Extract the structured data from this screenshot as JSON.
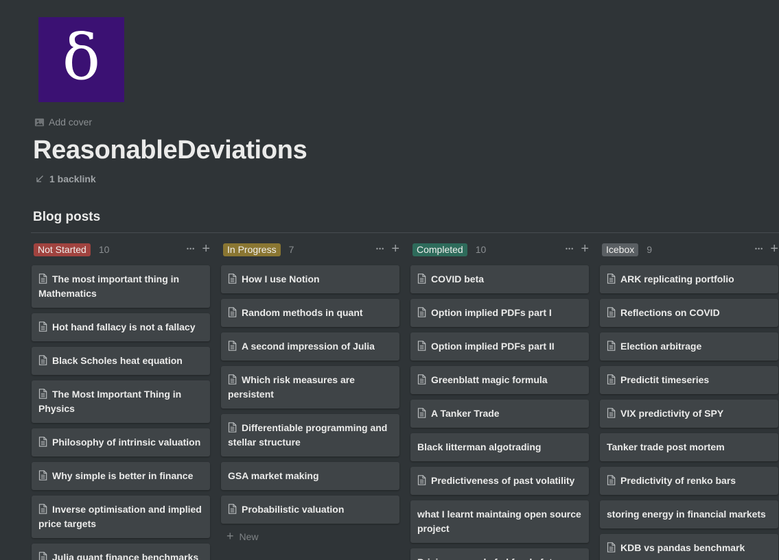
{
  "page": {
    "icon_glyph": "δ",
    "icon_bg": "#3b1173",
    "add_cover": "Add cover",
    "title": "ReasonableDeviations",
    "backlinks": "1 backlink"
  },
  "database": {
    "title": "Blog posts",
    "new_label": "New",
    "columns": [
      {
        "name": "Not Started",
        "count": "10",
        "color": "#a0433f",
        "cards": [
          {
            "title": "The most important thing in Mathematics",
            "icon": true
          },
          {
            "title": "Hot hand fallacy is not a fallacy",
            "icon": true
          },
          {
            "title": "Black Scholes heat equation",
            "icon": true
          },
          {
            "title": "The Most Important Thing in Physics",
            "icon": true
          },
          {
            "title": "Philosophy of intrinsic valuation",
            "icon": true
          },
          {
            "title": "Why simple is better in finance",
            "icon": true
          },
          {
            "title": "Inverse optimisation and implied price targets",
            "icon": true
          },
          {
            "title": "Julia quant finance benchmarks",
            "icon": true
          }
        ]
      },
      {
        "name": "In Progress",
        "count": "7",
        "color": "#8a7632",
        "cards": [
          {
            "title": "How I use Notion",
            "icon": true
          },
          {
            "title": "Random methods in quant",
            "icon": true
          },
          {
            "title": "A second impression of Julia",
            "icon": true
          },
          {
            "title": "Which risk measures are persistent",
            "icon": true
          },
          {
            "title": "Differentiable programming and stellar structure",
            "icon": true
          },
          {
            "title": "GSA market making",
            "icon": false
          },
          {
            "title": "Probabilistic valuation",
            "icon": true
          }
        ]
      },
      {
        "name": "Completed",
        "count": "10",
        "color": "#2e6b5b",
        "cards": [
          {
            "title": "COVID beta",
            "icon": true
          },
          {
            "title": "Option implied PDFs part I",
            "icon": true
          },
          {
            "title": "Option implied PDFs part II",
            "icon": true
          },
          {
            "title": "Greenblatt magic formula",
            "icon": true
          },
          {
            "title": "A Tanker Trade",
            "icon": true
          },
          {
            "title": "Black litterman algotrading",
            "icon": false
          },
          {
            "title": "Predictiveness of past volatility",
            "icon": true
          },
          {
            "title": "what I learnt maintaing open source project",
            "icon": false
          },
          {
            "title": "Pricing anomaly fed funds futures",
            "icon": false
          }
        ]
      },
      {
        "name": "Icebox",
        "count": "9",
        "color": "#5a5f63",
        "cards": [
          {
            "title": "ARK replicating portfolio",
            "icon": true
          },
          {
            "title": "Reflections on COVID",
            "icon": true
          },
          {
            "title": "Election arbitrage",
            "icon": true
          },
          {
            "title": "Predictit timeseries",
            "icon": true
          },
          {
            "title": "VIX predictivity of SPY",
            "icon": true
          },
          {
            "title": "Tanker trade post mortem",
            "icon": false
          },
          {
            "title": "Predictivity of renko bars",
            "icon": true
          },
          {
            "title": "storing energy in financial markets",
            "icon": false
          },
          {
            "title": "KDB vs pandas benchmark",
            "icon": true
          }
        ]
      }
    ]
  }
}
